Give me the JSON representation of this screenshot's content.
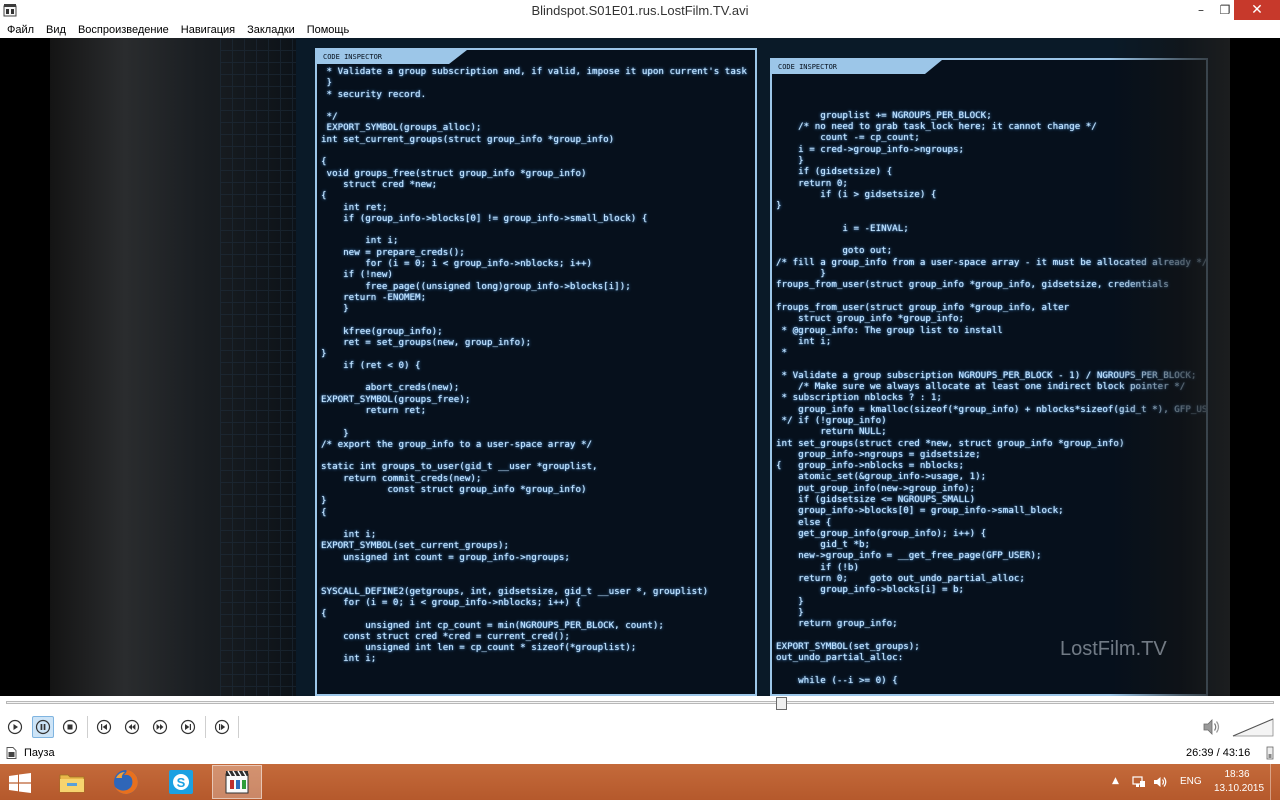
{
  "window": {
    "title": "Blindspot.S01E01.rus.LostFilm.TV.avi",
    "min_label": "–",
    "max_label": "❐",
    "close_label": "✕"
  },
  "menu": [
    "Файл",
    "Вид",
    "Воспроизведение",
    "Навигация",
    "Закладки",
    "Помощь"
  ],
  "video": {
    "watermark": "LostFilm.TV",
    "left_panel_tab": "CODE INSPECTOR",
    "right_panel_tab": "CODE INSPECTOR",
    "left_code": " * Validate a group subscription and, if valid, impose it upon current's task\n }\n * security record.\n\n */\n EXPORT_SYMBOL(groups_alloc);\nint set_current_groups(struct group_info *group_info)\n\n{\n void groups_free(struct group_info *group_info)\n    struct cred *new;\n{\n    int ret;\n    if (group_info->blocks[0] != group_info->small_block) {\n\n        int i;\n    new = prepare_creds();\n        for (i = 0; i < group_info->nblocks; i++)\n    if (!new)\n        free_page((unsigned long)group_info->blocks[i]);\n    return -ENOMEM;\n    }\n\n    kfree(group_info);\n    ret = set_groups(new, group_info);\n}\n    if (ret < 0) {\n\n        abort_creds(new);\nEXPORT_SYMBOL(groups_free);\n        return ret;\n\n    }\n/* export the group_info to a user-space array */\n\nstatic int groups_to_user(gid_t __user *grouplist,\n    return commit_creds(new);\n            const struct group_info *group_info)\n}\n{\n\n    int i;\nEXPORT_SYMBOL(set_current_groups);\n    unsigned int count = group_info->ngroups;\n\n\nSYSCALL_DEFINE2(getgroups, int, gidsetsize, gid_t __user *, grouplist)\n    for (i = 0; i < group_info->nblocks; i++) {\n{\n        unsigned int cp_count = min(NGROUPS_PER_BLOCK, count);\n    const struct cred *cred = current_cred();\n        unsigned int len = cp_count * sizeof(*grouplist);\n    int i;",
    "right_code": "\n\n\n        grouplist += NGROUPS_PER_BLOCK;\n    /* no need to grab task_lock here; it cannot change */\n        count -= cp_count;\n    i = cred->group_info->ngroups;\n    }\n    if (gidsetsize) {\n    return 0;\n        if (i > gidsetsize) {\n}\n\n            i = -EINVAL;\n\n            goto out;\n/* fill a group_info from a user-space array - it must be allocated already */\n        }\nfroups_from_user(struct group_info *group_info, gidsetsize, credentials\n\nfroups_from_user(struct group_info *group_info, alter\n    struct group_info *group_info;\n * @group_info: The group list to install\n    int i;\n *\n\n * Validate a group subscription NGROUPS_PER_BLOCK - 1) / NGROUPS_PER_BLOCK;\n    /* Make sure we always allocate at least one indirect block pointer */\n * subscription nblocks ? : 1;\n    group_info = kmalloc(sizeof(*group_info) + nblocks*sizeof(gid_t *), GFP_USER);\n */ if (!group_info)\n        return NULL;\nint set_groups(struct cred *new, struct group_info *group_info)\n    group_info->ngroups = gidsetsize;\n{   group_info->nblocks = nblocks;\n    atomic_set(&group_info->usage, 1);\n    put_group_info(new->group_info);\n    if (gidsetsize <= NGROUPS_SMALL)\n    group_info->blocks[0] = group_info->small_block;\n    else {\n    get_group_info(group_info); i++) {\n        gid_t *b;\n    new->group_info = __get_free_page(GFP_USER);\n        if (!b)\n    return 0;    goto out_undo_partial_alloc;\n        group_info->blocks[i] = b;\n    }\n    }\n    return group_info;\n\nEXPORT_SYMBOL(set_groups);\nout_undo_partial_alloc:\n\n    while (--i >= 0) {\n\n        free_page((unsigned long)group_info->blocks[i]);"
  },
  "seek": {
    "progress": 0.6118
  },
  "status": {
    "state": "Пауза",
    "time": "26:39 / 43:16"
  },
  "tray": {
    "lang": "ENG",
    "time": "18:36",
    "date": "13.10.2015",
    "up_arrow": "▲"
  },
  "colors": {
    "close": "#c7392b",
    "taskbar": "#c46a3a",
    "active_button": "#cde4f7",
    "code_glow": "#c6e6ff"
  }
}
